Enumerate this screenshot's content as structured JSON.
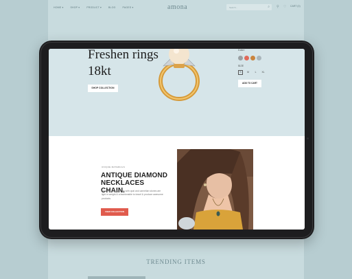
{
  "background_site": {
    "nav": [
      "HOME ▾",
      "SHOP ▾",
      "PRODUCT ▾",
      "BLOG",
      "PAGES ▾"
    ],
    "logo": "amona",
    "search_placeholder": "Search...",
    "cart": "CART (0)",
    "section_title": "TRENDING ITEMS"
  },
  "hero": {
    "title": "Freshen rings 18kt",
    "cta": "SHOP COLLECTION",
    "color_label": "Color:",
    "swatches": [
      "#9aa0a3",
      "#e06a5a",
      "#c9843e",
      "#aab6bb"
    ],
    "size_label": "SIZE",
    "sizes": [
      "S",
      "M",
      "L",
      "XL"
    ],
    "selected_size": "S",
    "add_to_cart": "ADD TO CART"
  },
  "promo": {
    "kicker": "UNIQUE MATERIALS",
    "title": "ANTIQUE DIAMOND NECKLACES CHAIN.",
    "body": "Beautiful long earrings with opal and carnelian stones are light in weight & a fashionable to travel & produce awesome products.",
    "cta": "VIEW COLLECTION"
  }
}
